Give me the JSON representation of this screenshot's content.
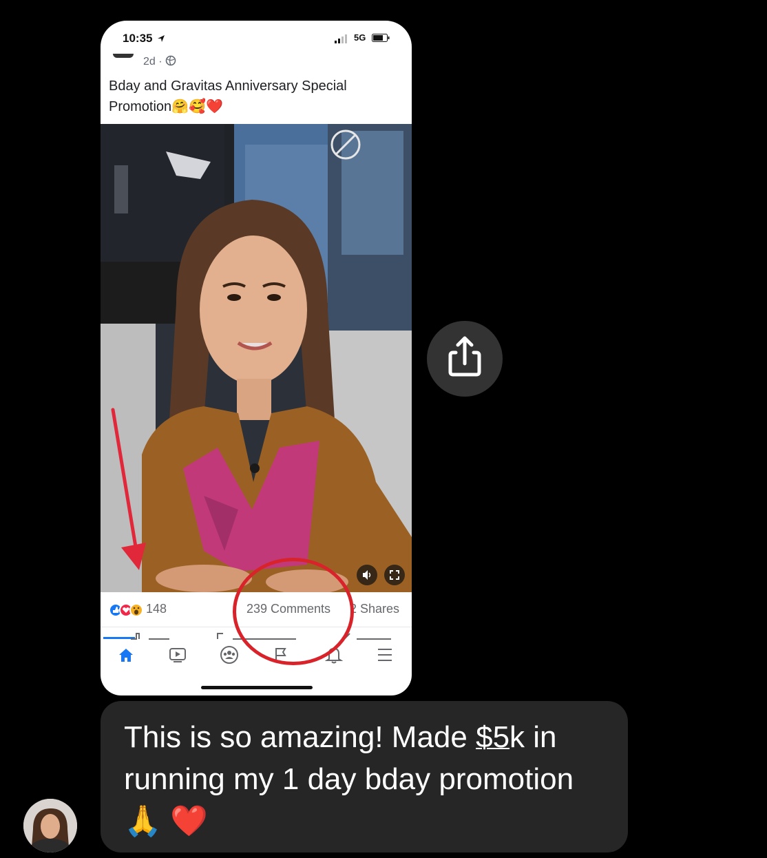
{
  "phone": {
    "time": "10:35",
    "network": "5G",
    "post": {
      "age": "2d ·",
      "text": "Bday and Gravitas Anniversary Special Promotion🤗🥰❤️"
    },
    "stats": {
      "reactions_count": "148",
      "comments": "239 Comments",
      "shares": "2 Shares"
    },
    "tabs": [
      "home-icon",
      "watch-icon",
      "groups-icon",
      "pages-flag-icon",
      "notifications-bell-icon",
      "menu-icon"
    ],
    "accent": "#1877f2"
  },
  "annotations": {
    "circle_color": "#d8232a",
    "arrow_color": "#e0283a"
  },
  "share": {
    "icon": "share-icon"
  },
  "message": {
    "text_before": "This is so amazing! Made ",
    "amount": "$5",
    "text_after": "k in running my 1 day bday promotion",
    "emoji": "🙏 ❤️"
  }
}
